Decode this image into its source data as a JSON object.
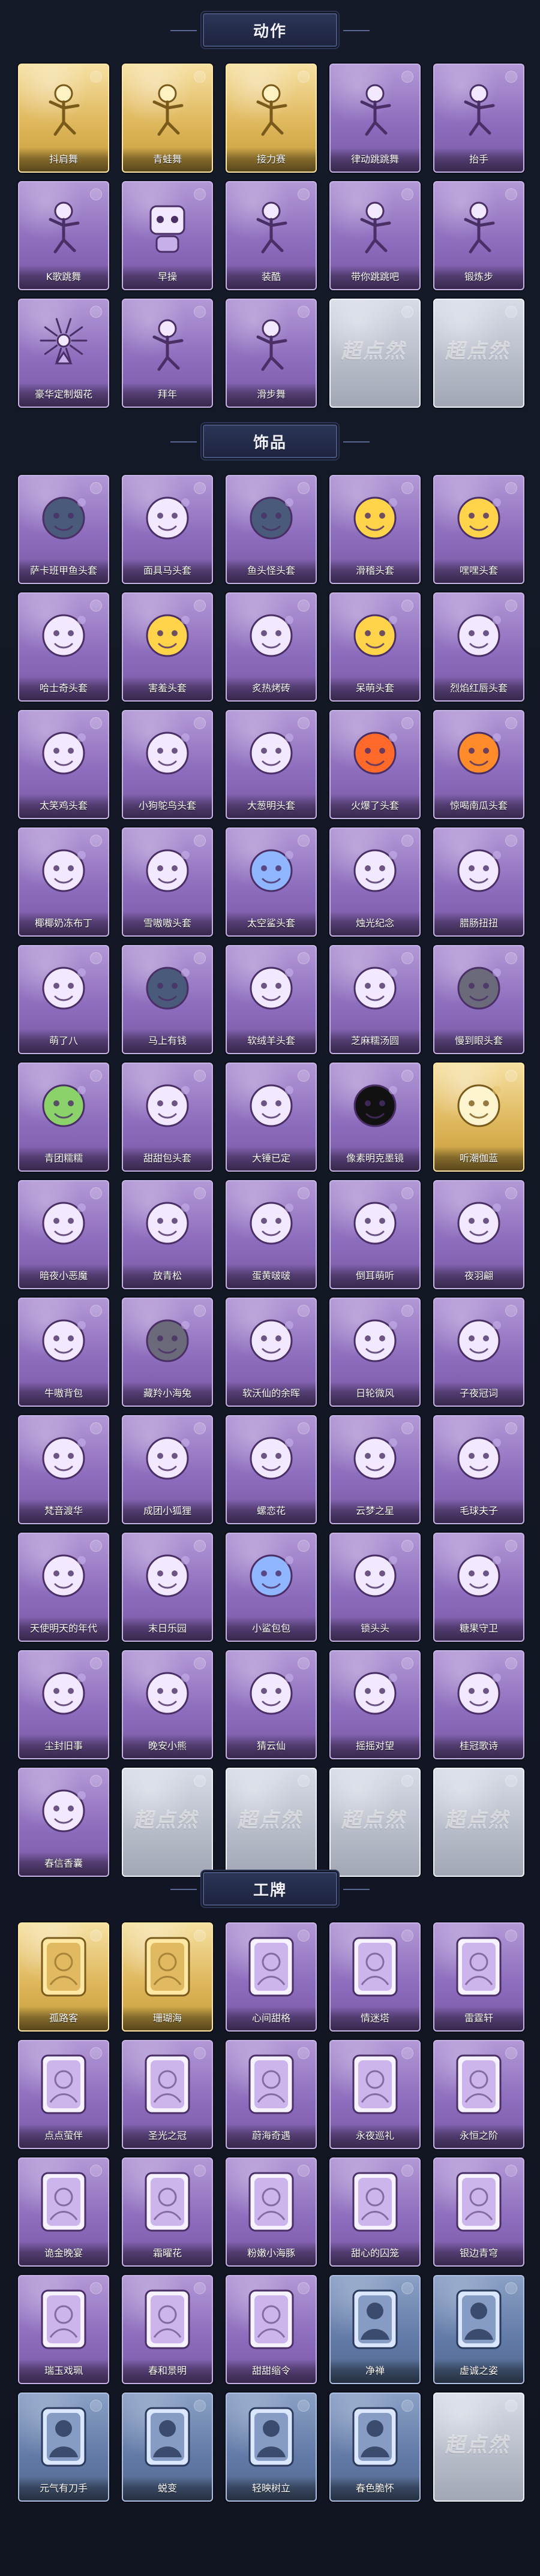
{
  "sections": [
    {
      "title": "动作",
      "items": [
        {
          "label": "抖肩舞",
          "icon": "dance-pose-icon",
          "rarity": "gold"
        },
        {
          "label": "青蛙舞",
          "icon": "dance-pose-icon",
          "rarity": "gold"
        },
        {
          "label": "接力赛",
          "icon": "dance-pose-icon",
          "rarity": "gold"
        },
        {
          "label": "律动跳跳舞",
          "icon": "dance-pose-icon",
          "rarity": "purple"
        },
        {
          "label": "抬手",
          "icon": "dance-pose-icon",
          "rarity": "purple"
        },
        {
          "label": "K歌跳舞",
          "icon": "dance-pose-icon",
          "rarity": "purple"
        },
        {
          "label": "早操",
          "icon": "robot-icon",
          "rarity": "purple"
        },
        {
          "label": "装酷",
          "icon": "dance-pose-icon",
          "rarity": "purple"
        },
        {
          "label": "带你跳跳吧",
          "icon": "dance-pose-icon",
          "rarity": "purple"
        },
        {
          "label": "锻炼步",
          "icon": "dance-pose-icon",
          "rarity": "purple"
        },
        {
          "label": "豪华定制烟花",
          "icon": "fireworks-icon",
          "rarity": "purple"
        },
        {
          "label": "拜年",
          "icon": "dance-pose-icon",
          "rarity": "purple"
        },
        {
          "label": "滑步舞",
          "icon": "dance-pose-icon",
          "rarity": "purple"
        },
        {
          "label": "",
          "icon": "locked-placeholder-icon",
          "rarity": "silver",
          "watermark": "超点然"
        },
        {
          "label": "",
          "icon": "locked-placeholder-icon",
          "rarity": "silver",
          "watermark": "超点然"
        }
      ]
    },
    {
      "title": "饰品",
      "items": [
        {
          "label": "萨卡班甲鱼头套",
          "icon": "fish-head-icon",
          "rarity": "purple"
        },
        {
          "label": "面具马头套",
          "icon": "horse-head-icon",
          "rarity": "purple"
        },
        {
          "label": "鱼头怪头套",
          "icon": "green-fish-icon",
          "rarity": "purple"
        },
        {
          "label": "滑稽头套",
          "icon": "smiley-icon",
          "rarity": "purple"
        },
        {
          "label": "嘿嘿头套",
          "icon": "smiley-icon",
          "rarity": "purple"
        },
        {
          "label": "哈士奇头套",
          "icon": "dog-head-icon",
          "rarity": "purple"
        },
        {
          "label": "害羞头套",
          "icon": "smiley-icon",
          "rarity": "purple"
        },
        {
          "label": "炙热烤砖",
          "icon": "toast-icon",
          "rarity": "purple"
        },
        {
          "label": "呆萌头套",
          "icon": "smiley-icon",
          "rarity": "purple"
        },
        {
          "label": "烈焰红唇头套",
          "icon": "duck-head-icon",
          "rarity": "purple"
        },
        {
          "label": "太笑鸡头套",
          "icon": "chicken-head-icon",
          "rarity": "purple"
        },
        {
          "label": "小狗鸵鸟头套",
          "icon": "bird-head-icon",
          "rarity": "purple"
        },
        {
          "label": "大葱明头套",
          "icon": "leek-icon",
          "rarity": "purple"
        },
        {
          "label": "火爆了头套",
          "icon": "fire-icon",
          "rarity": "purple"
        },
        {
          "label": "惊喝南瓜头套",
          "icon": "pumpkin-icon",
          "rarity": "purple"
        },
        {
          "label": "椰椰奶冻布丁",
          "icon": "pudding-icon",
          "rarity": "purple"
        },
        {
          "label": "雪嗷嗷头套",
          "icon": "snowman-icon",
          "rarity": "purple"
        },
        {
          "label": "太空鲨头套",
          "icon": "shark-icon",
          "rarity": "purple"
        },
        {
          "label": "烛光纪念",
          "icon": "candle-icon",
          "rarity": "purple"
        },
        {
          "label": "腊肠扭扭",
          "icon": "sausage-dog-icon",
          "rarity": "purple"
        },
        {
          "label": "萌了八",
          "icon": "garlic-icon",
          "rarity": "purple"
        },
        {
          "label": "马上有钱",
          "icon": "fish-hat-icon",
          "rarity": "purple"
        },
        {
          "label": "软绒羊头套",
          "icon": "sheep-icon",
          "rarity": "purple"
        },
        {
          "label": "芝麻糯汤圆",
          "icon": "dumpling-icon",
          "rarity": "purple"
        },
        {
          "label": "慢到眼头套",
          "icon": "cat-head-icon",
          "rarity": "purple"
        },
        {
          "label": "青团糯糯",
          "icon": "green-dumpling-icon",
          "rarity": "purple"
        },
        {
          "label": "甜甜包头套",
          "icon": "sun-bun-icon",
          "rarity": "purple"
        },
        {
          "label": "大锤已定",
          "icon": "scarf-icon",
          "rarity": "purple"
        },
        {
          "label": "像素明克墨镜",
          "icon": "pixel-sunglasses-icon",
          "rarity": "purple"
        },
        {
          "label": "听潮伽蓝",
          "icon": "halo-icon",
          "rarity": "gold"
        },
        {
          "label": "暗夜小恶魔",
          "icon": "little-devil-icon",
          "rarity": "purple"
        },
        {
          "label": "放青松",
          "icon": "empty-card-icon",
          "rarity": "purple"
        },
        {
          "label": "蛋黄啵啵",
          "icon": "chick-icon",
          "rarity": "purple"
        },
        {
          "label": "倒耳萌听",
          "icon": "flower-ring-icon",
          "rarity": "purple"
        },
        {
          "label": "夜羽翩",
          "icon": "ice-crown-icon",
          "rarity": "purple"
        },
        {
          "label": "牛嗷背包",
          "icon": "cow-backpack-icon",
          "rarity": "purple"
        },
        {
          "label": "藏羚小海兔",
          "icon": "blue-cat-icon",
          "rarity": "purple"
        },
        {
          "label": "软沃仙的余晖",
          "icon": "figure-doll-icon",
          "rarity": "purple"
        },
        {
          "label": "日轮微风",
          "icon": "white-sock-icon",
          "rarity": "purple"
        },
        {
          "label": "子夜冠词",
          "icon": "crow-doll-icon",
          "rarity": "purple"
        },
        {
          "label": "梵音渡华",
          "icon": "figure-doll-icon",
          "rarity": "purple"
        },
        {
          "label": "成团小狐狸",
          "icon": "fox-doll-icon",
          "rarity": "purple"
        },
        {
          "label": "螺恋花",
          "icon": "flower-lantern-icon",
          "rarity": "purple"
        },
        {
          "label": "云梦之星",
          "icon": "unicorn-icon",
          "rarity": "purple"
        },
        {
          "label": "毛球夫子",
          "icon": "hamster-icon",
          "rarity": "purple"
        },
        {
          "label": "天使明天的年代",
          "icon": "figure-doll-icon",
          "rarity": "purple"
        },
        {
          "label": "末日乐园",
          "icon": "figure-doll-icon",
          "rarity": "purple"
        },
        {
          "label": "小鲨包包",
          "icon": "shark-keychain-icon",
          "rarity": "purple"
        },
        {
          "label": "锁头头",
          "icon": "flower-doll-icon",
          "rarity": "purple"
        },
        {
          "label": "糖果守卫",
          "icon": "keychain-icon",
          "rarity": "purple"
        },
        {
          "label": "尘封旧事",
          "icon": "figure-doll-icon",
          "rarity": "purple"
        },
        {
          "label": "晚安小熊",
          "icon": "bear-keychain-icon",
          "rarity": "purple"
        },
        {
          "label": "猜云仙",
          "icon": "keychain-icon",
          "rarity": "purple"
        },
        {
          "label": "摇摇对望",
          "icon": "keychain-icon",
          "rarity": "purple"
        },
        {
          "label": "桂冠歌诗",
          "icon": "keychain-icon",
          "rarity": "purple"
        },
        {
          "label": "春信香囊",
          "icon": "sachet-icon",
          "rarity": "purple"
        },
        {
          "label": "",
          "icon": "locked-placeholder-icon",
          "rarity": "silver",
          "watermark": "超点然"
        },
        {
          "label": "",
          "icon": "locked-placeholder-icon",
          "rarity": "silver",
          "watermark": "超点然"
        },
        {
          "label": "",
          "icon": "locked-placeholder-icon",
          "rarity": "silver",
          "watermark": "超点然"
        },
        {
          "label": "",
          "icon": "locked-placeholder-icon",
          "rarity": "silver",
          "watermark": "超点然"
        }
      ]
    },
    {
      "title": "工牌",
      "items": [
        {
          "label": "孤路客",
          "icon": "badge-frame-icon",
          "rarity": "gold"
        },
        {
          "label": "珊瑚海",
          "icon": "badge-frame-icon",
          "rarity": "gold"
        },
        {
          "label": "心间甜格",
          "icon": "badge-frame-icon",
          "rarity": "purple"
        },
        {
          "label": "情迷塔",
          "icon": "badge-frame-icon",
          "rarity": "purple"
        },
        {
          "label": "雷霆轩",
          "icon": "badge-frame-icon",
          "rarity": "purple"
        },
        {
          "label": "点点萤伴",
          "icon": "badge-frame-icon",
          "rarity": "purple"
        },
        {
          "label": "圣光之冠",
          "icon": "badge-frame-icon",
          "rarity": "purple"
        },
        {
          "label": "蔚海奇遇",
          "icon": "badge-frame-icon",
          "rarity": "purple"
        },
        {
          "label": "永夜巡礼",
          "icon": "badge-frame-icon",
          "rarity": "purple"
        },
        {
          "label": "永恒之阶",
          "icon": "badge-frame-icon",
          "rarity": "purple"
        },
        {
          "label": "诡金晚宴",
          "icon": "badge-frame-icon",
          "rarity": "purple"
        },
        {
          "label": "霜曜花",
          "icon": "badge-frame-icon",
          "rarity": "purple"
        },
        {
          "label": "粉嫩小海豚",
          "icon": "badge-frame-icon",
          "rarity": "purple"
        },
        {
          "label": "甜心的囚笼",
          "icon": "badge-frame-icon",
          "rarity": "purple"
        },
        {
          "label": "银边青穹",
          "icon": "badge-frame-icon",
          "rarity": "purple"
        },
        {
          "label": "瑞玉戏珮",
          "icon": "badge-frame-icon",
          "rarity": "purple"
        },
        {
          "label": "春和景明",
          "icon": "badge-frame-icon",
          "rarity": "purple"
        },
        {
          "label": "甜甜缩令",
          "icon": "badge-frame-icon",
          "rarity": "purple"
        },
        {
          "label": "净禅",
          "icon": "badge-silhouette-icon",
          "rarity": "blue"
        },
        {
          "label": "虚诚之姿",
          "icon": "badge-silhouette-icon",
          "rarity": "blue"
        },
        {
          "label": "元气有刀手",
          "icon": "badge-silhouette-icon",
          "rarity": "blue"
        },
        {
          "label": "蜕变",
          "icon": "badge-silhouette-icon",
          "rarity": "blue"
        },
        {
          "label": "轻映树立",
          "icon": "badge-silhouette-icon",
          "rarity": "blue"
        },
        {
          "label": "春色脆怀",
          "icon": "badge-silhouette-icon",
          "rarity": "blue"
        },
        {
          "label": "",
          "icon": "locked-placeholder-icon",
          "rarity": "silver",
          "watermark": "超点然"
        }
      ]
    }
  ],
  "colors": {
    "page_bg": "#121624",
    "header_bg": "#2b3556",
    "purple_card": "#8d6dbd",
    "gold_card": "#dfb75c",
    "silver_card": "#b6bbc8",
    "blue_card": "#6179a6"
  }
}
